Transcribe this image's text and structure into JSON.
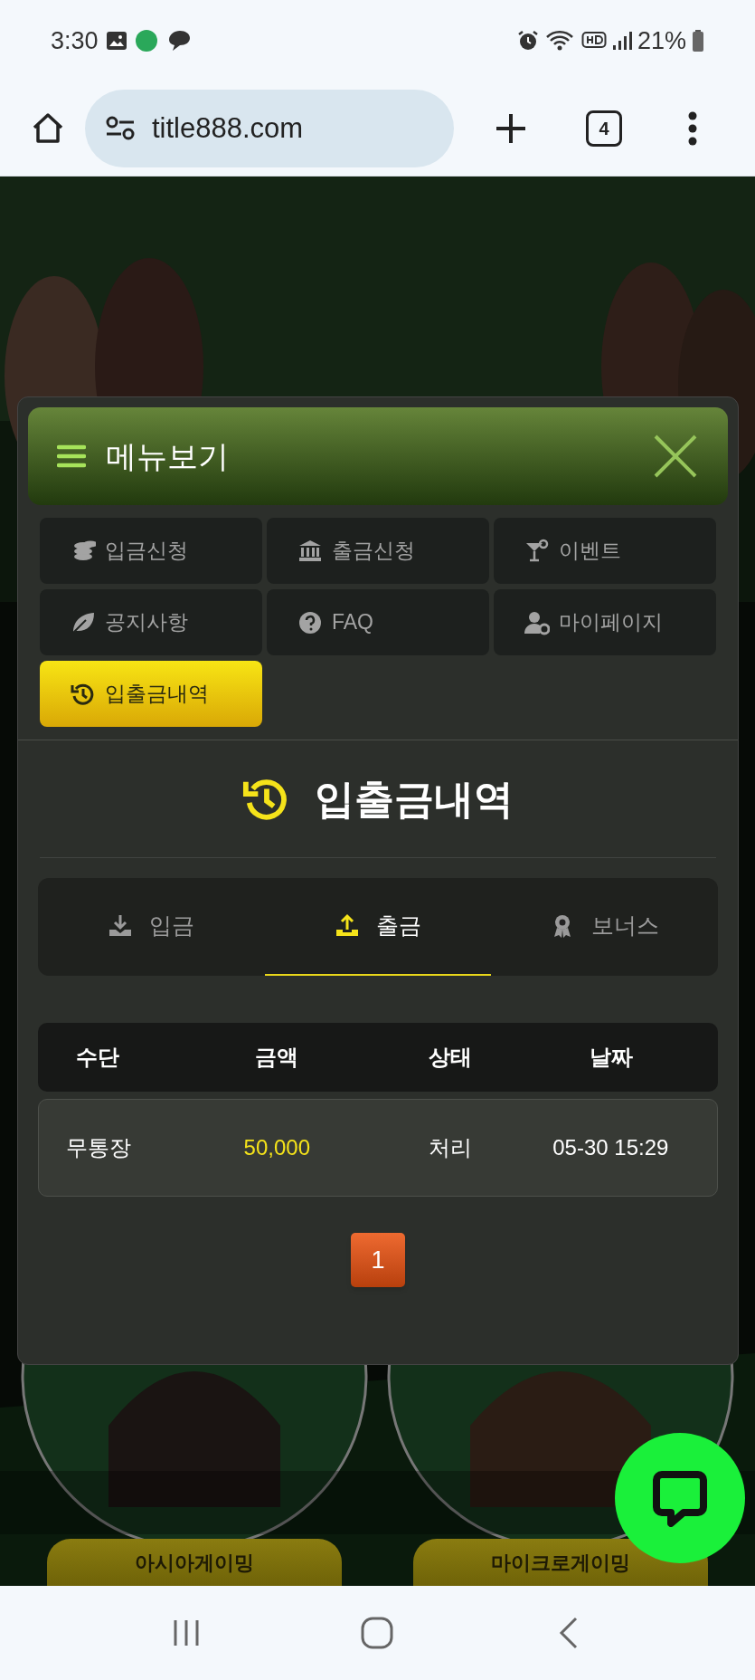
{
  "status_bar": {
    "time": "3:30",
    "battery": "21%"
  },
  "browser": {
    "url": "title888.com",
    "tab_count": "4"
  },
  "menu": {
    "title": "메뉴보기",
    "items": [
      {
        "label": "입금신청",
        "selected": false
      },
      {
        "label": "출금신청",
        "selected": false
      },
      {
        "label": "이벤트",
        "selected": false
      },
      {
        "label": "공지사항",
        "selected": false
      },
      {
        "label": "FAQ",
        "selected": false
      },
      {
        "label": "마이페이지",
        "selected": false
      },
      {
        "label": "입출금내역",
        "selected": true
      }
    ]
  },
  "history": {
    "title": "입출금내역",
    "tabs": [
      {
        "label": "입금",
        "selected": false
      },
      {
        "label": "출금",
        "selected": true
      },
      {
        "label": "보너스",
        "selected": false
      }
    ],
    "table": {
      "columns": [
        "수단",
        "금액",
        "상태",
        "날짜"
      ],
      "rows": [
        {
          "method": "무통장",
          "amount": "50,000",
          "status": "처리",
          "date": "05-30 15:29"
        }
      ]
    },
    "pagination": [
      {
        "label": "1",
        "selected": true
      }
    ]
  },
  "games": [
    {
      "label": "아시아게이밍"
    },
    {
      "label": "마이크로게이밍"
    }
  ]
}
